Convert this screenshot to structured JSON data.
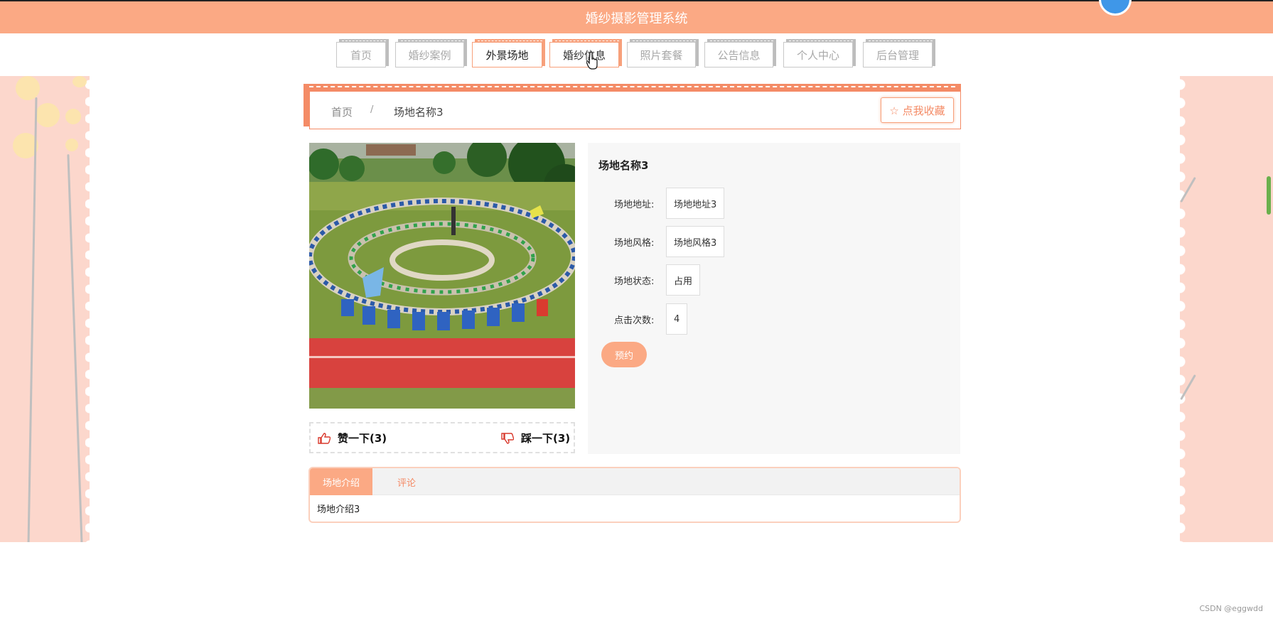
{
  "header": {
    "title": "婚纱摄影管理系统"
  },
  "nav": [
    "首页",
    "婚纱案例",
    "外景场地",
    "婚纱信息",
    "照片套餐",
    "公告信息",
    "个人中心",
    "后台管理"
  ],
  "breadcrumb": {
    "home": "首页",
    "sep": "/",
    "current": "场地名称3"
  },
  "favorite": {
    "label": "☆ 点我收藏"
  },
  "likes": {
    "like": "赞一下(3)",
    "dislike": "踩一下(3)"
  },
  "details": {
    "title": "场地名称3",
    "rows": [
      {
        "label": "场地地址:",
        "value": "场地地址3"
      },
      {
        "label": "场地风格:",
        "value": "场地风格3"
      },
      {
        "label": "场地状态:",
        "value": "占用"
      },
      {
        "label": "点击次数:",
        "value": "4"
      }
    ],
    "book": "预约"
  },
  "tabs": {
    "active": "场地介绍",
    "other": "评论",
    "content": "场地介绍3"
  },
  "watermark": "CSDN @eggwdd",
  "colors": {
    "accent": "#fba984",
    "accent_dark": "#f48b66",
    "side": "#fcd7cc"
  }
}
